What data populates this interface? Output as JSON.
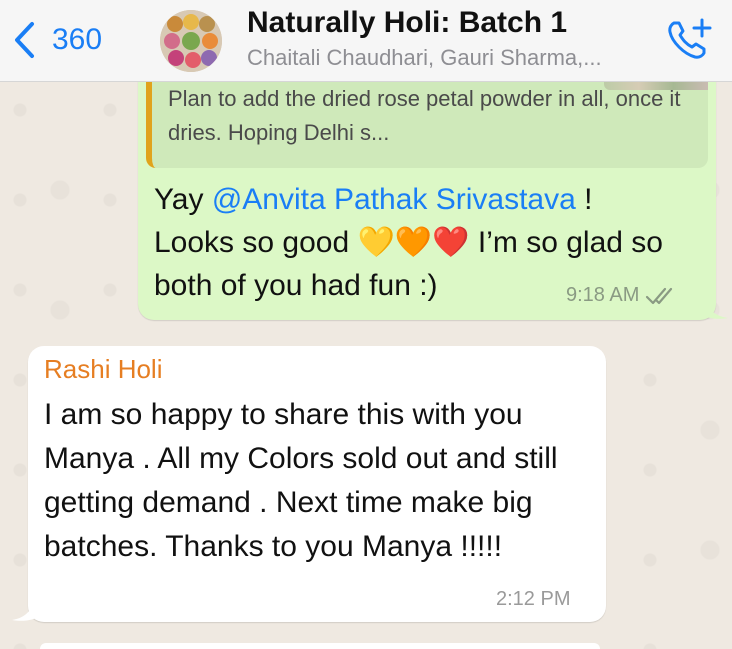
{
  "header": {
    "back_count": "360",
    "title": "Naturally Holi: Batch 1",
    "subtitle": "Chaitali Chaudhari, Gauri Sharma,...",
    "call_icon": "phone-plus-icon",
    "back_icon": "chevron-left-icon",
    "accent": "#1a7ef5"
  },
  "outgoing": {
    "quote_text": "Plan to add the dried rose petal powder in all, once it dries. Hoping Delhi s...",
    "prefix": "Yay ",
    "mention": "@Anvita Pathak Srivastava",
    "after_mention": " !",
    "line2": "Looks so good ",
    "hearts": "💛🧡❤️",
    "line2_end": " I’m so glad so both of you had fun :)",
    "time": "9:18 AM",
    "status": "read",
    "bubble_color": "#dcf8c6"
  },
  "incoming": {
    "sender": "Rashi Holi",
    "text": "I am so happy to share this with you Manya . All my Colors sold out and still getting demand . Next time make big batches. Thanks to you Manya !!!!!",
    "time": "2:12 PM",
    "sender_color": "#e67e22"
  }
}
